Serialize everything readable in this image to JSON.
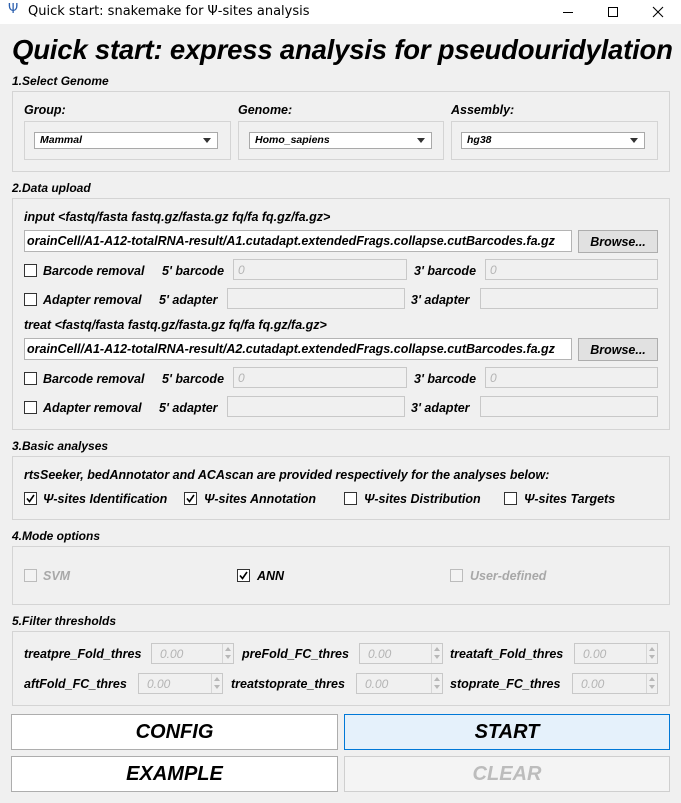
{
  "window": {
    "title": "Quick start: snakemake for Ψ-sites analysis",
    "icon_glyph": "Ψ"
  },
  "main_title": "Quick start: express analysis for pseudouridylation",
  "genome": {
    "section": "1.Select Genome",
    "group_label": "Group:",
    "group_value": "Mammal",
    "genome_label": "Genome:",
    "genome_value": "Homo_sapiens",
    "assembly_label": "Assembly:",
    "assembly_value": "hg38"
  },
  "upload": {
    "section": "2.Data upload",
    "input": {
      "label": "input <fastq/fasta fastq.gz/fasta.gz fq/fa fq.gz/fa.gz>",
      "path": "orainCell/A1-A12-totalRNA-result/A1.cutadapt.extendedFrags.collapse.cutBarcodes.fa.gz",
      "browse": "Browse...",
      "barcode_removal": "Barcode removal",
      "barcode5_label": "5' barcode",
      "barcode5_placeholder": "0",
      "barcode3_label": "3' barcode",
      "barcode3_placeholder": "0",
      "adapter_removal": "Adapter removal",
      "adapter5_label": "5' adapter",
      "adapter3_label": "3' adapter"
    },
    "treat": {
      "label": "treat <fastq/fasta fastq.gz/fasta.gz fq/fa fq.gz/fa.gz>",
      "path": "orainCell/A1-A12-totalRNA-result/A2.cutadapt.extendedFrags.collapse.cutBarcodes.fa.gz",
      "browse": "Browse...",
      "barcode_removal": "Barcode removal",
      "barcode5_label": "5' barcode",
      "barcode5_placeholder": "0",
      "barcode3_label": "3' barcode",
      "barcode3_placeholder": "0",
      "adapter_removal": "Adapter removal",
      "adapter5_label": "5' adapter",
      "adapter3_label": "3' adapter"
    }
  },
  "basic": {
    "section": "3.Basic analyses",
    "description": "rtsSeeker, bedAnnotator and ACAscan are provided respectively for the analyses below:",
    "items": [
      {
        "label": "Ψ-sites Identification",
        "checked": true
      },
      {
        "label": "Ψ-sites Annotation",
        "checked": true
      },
      {
        "label": "Ψ-sites Distribution",
        "checked": false
      },
      {
        "label": "Ψ-sites Targets",
        "checked": false
      }
    ]
  },
  "mode": {
    "section": "4.Mode options",
    "svm": "SVM",
    "ann": "ANN",
    "user_defined": "User-defined",
    "svm_checked": false,
    "ann_checked": true,
    "user_checked": false
  },
  "filter": {
    "section": "5.Filter thresholds",
    "row1": [
      {
        "label": "treatpre_Fold_thres",
        "value": "0.00"
      },
      {
        "label": "preFold_FC_thres",
        "value": "0.00"
      },
      {
        "label": "treataft_Fold_thres",
        "value": "0.00"
      }
    ],
    "row2": [
      {
        "label": "aftFold_FC_thres",
        "value": "0.00"
      },
      {
        "label": "treatstoprate_thres",
        "value": "0.00"
      },
      {
        "label": "stoprate_FC_thres",
        "value": "0.00"
      }
    ]
  },
  "buttons": {
    "config": "CONFIG",
    "start": "START",
    "example": "EXAMPLE",
    "clear": "CLEAR"
  },
  "icons": {
    "app": "psi-icon",
    "minimize": "minimize-icon",
    "maximize": "maximize-icon",
    "close": "close-icon",
    "dropdown": "chevron-down-icon",
    "check": "checkmark-icon",
    "spin": "spin-arrows-icon"
  },
  "colors": {
    "focus_border": "#0078d7",
    "focus_fill": "#e5f1fb",
    "window_bg": "#f0f0f0",
    "disabled_text": "#b4b4b4"
  }
}
